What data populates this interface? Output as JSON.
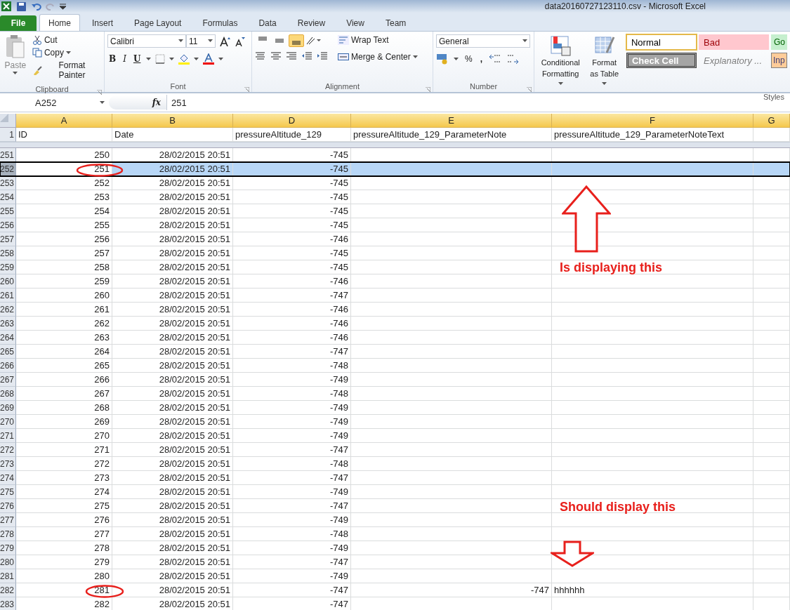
{
  "window": {
    "title": "data20160727123110.csv  -  Microsoft Excel"
  },
  "ribbon": {
    "file_tab": "File",
    "tabs": [
      {
        "label": "Home",
        "selected": true
      },
      {
        "label": "Insert",
        "selected": false
      },
      {
        "label": "Page Layout",
        "selected": false
      },
      {
        "label": "Formulas",
        "selected": false
      },
      {
        "label": "Data",
        "selected": false
      },
      {
        "label": "Review",
        "selected": false
      },
      {
        "label": "View",
        "selected": false
      },
      {
        "label": "Team",
        "selected": false
      }
    ],
    "clipboard": {
      "label": "Clipboard",
      "paste": "Paste",
      "cut": "Cut",
      "copy": "Copy",
      "format_painter": "Format Painter"
    },
    "font": {
      "label": "Font",
      "family": "Calibri",
      "size": "11",
      "bold": "B",
      "italic": "I",
      "underline": "U"
    },
    "alignment": {
      "label": "Alignment",
      "wrap_text": "Wrap Text",
      "merge_center": "Merge & Center",
      "vertical_buttons": [
        {
          "kind": "top",
          "selected": false
        },
        {
          "kind": "middle",
          "selected": false
        },
        {
          "kind": "bottom",
          "selected": true
        }
      ]
    },
    "number": {
      "label": "Number",
      "format": "General",
      "percent": "%",
      "comma": ","
    },
    "styles": {
      "label": "Styles",
      "conditional_formatting": [
        "Conditional",
        "Formatting"
      ],
      "format_as_table": [
        "Format",
        "as Table"
      ],
      "cells": [
        {
          "kind": "normal",
          "text": "Normal",
          "selected": true
        },
        {
          "kind": "bad",
          "text": "Bad",
          "selected": false
        },
        {
          "kind": "good",
          "text": "Go",
          "selected": false
        },
        {
          "kind": "check",
          "text": "Check Cell",
          "selected": false
        },
        {
          "kind": "explanatory",
          "text": "Explanatory ...",
          "selected": false
        },
        {
          "kind": "input",
          "text": "Inp",
          "selected": false
        }
      ]
    }
  },
  "formula_bar": {
    "name_box": "A252",
    "fx": "fx",
    "value": "251"
  },
  "sheet": {
    "columns": [
      "A",
      "B",
      "D",
      "E",
      "F",
      "G"
    ],
    "header_row": {
      "row": "1",
      "cells": [
        "ID",
        "Date",
        "pressureAltitude_129",
        "pressureAltitude_129_ParameterNote",
        "pressureAltitude_129_ParameterNoteText"
      ]
    },
    "rows": [
      {
        "row": "251",
        "id": "250",
        "date": "28/02/2015 20:51",
        "pressure": "-745",
        "selected": false
      },
      {
        "row": "252",
        "id": "251",
        "date": "28/02/2015 20:51",
        "pressure": "-745",
        "selected": true
      },
      {
        "row": "253",
        "id": "252",
        "date": "28/02/2015 20:51",
        "pressure": "-745",
        "selected": false
      },
      {
        "row": "254",
        "id": "253",
        "date": "28/02/2015 20:51",
        "pressure": "-745",
        "selected": false
      },
      {
        "row": "255",
        "id": "254",
        "date": "28/02/2015 20:51",
        "pressure": "-745",
        "selected": false
      },
      {
        "row": "256",
        "id": "255",
        "date": "28/02/2015 20:51",
        "pressure": "-745",
        "selected": false
      },
      {
        "row": "257",
        "id": "256",
        "date": "28/02/2015 20:51",
        "pressure": "-746",
        "selected": false
      },
      {
        "row": "258",
        "id": "257",
        "date": "28/02/2015 20:51",
        "pressure": "-745",
        "selected": false
      },
      {
        "row": "259",
        "id": "258",
        "date": "28/02/2015 20:51",
        "pressure": "-745",
        "selected": false
      },
      {
        "row": "260",
        "id": "259",
        "date": "28/02/2015 20:51",
        "pressure": "-746",
        "selected": false
      },
      {
        "row": "261",
        "id": "260",
        "date": "28/02/2015 20:51",
        "pressure": "-747",
        "selected": false
      },
      {
        "row": "262",
        "id": "261",
        "date": "28/02/2015 20:51",
        "pressure": "-746",
        "selected": false
      },
      {
        "row": "263",
        "id": "262",
        "date": "28/02/2015 20:51",
        "pressure": "-746",
        "selected": false
      },
      {
        "row": "264",
        "id": "263",
        "date": "28/02/2015 20:51",
        "pressure": "-746",
        "selected": false
      },
      {
        "row": "265",
        "id": "264",
        "date": "28/02/2015 20:51",
        "pressure": "-747",
        "selected": false
      },
      {
        "row": "266",
        "id": "265",
        "date": "28/02/2015 20:51",
        "pressure": "-748",
        "selected": false
      },
      {
        "row": "267",
        "id": "266",
        "date": "28/02/2015 20:51",
        "pressure": "-749",
        "selected": false
      },
      {
        "row": "268",
        "id": "267",
        "date": "28/02/2015 20:51",
        "pressure": "-748",
        "selected": false
      },
      {
        "row": "269",
        "id": "268",
        "date": "28/02/2015 20:51",
        "pressure": "-749",
        "selected": false
      },
      {
        "row": "270",
        "id": "269",
        "date": "28/02/2015 20:51",
        "pressure": "-749",
        "selected": false
      },
      {
        "row": "271",
        "id": "270",
        "date": "28/02/2015 20:51",
        "pressure": "-749",
        "selected": false
      },
      {
        "row": "272",
        "id": "271",
        "date": "28/02/2015 20:51",
        "pressure": "-747",
        "selected": false
      },
      {
        "row": "273",
        "id": "272",
        "date": "28/02/2015 20:51",
        "pressure": "-748",
        "selected": false
      },
      {
        "row": "274",
        "id": "273",
        "date": "28/02/2015 20:51",
        "pressure": "-747",
        "selected": false
      },
      {
        "row": "275",
        "id": "274",
        "date": "28/02/2015 20:51",
        "pressure": "-749",
        "selected": false
      },
      {
        "row": "276",
        "id": "275",
        "date": "28/02/2015 20:51",
        "pressure": "-747",
        "selected": false
      },
      {
        "row": "277",
        "id": "276",
        "date": "28/02/2015 20:51",
        "pressure": "-749",
        "selected": false
      },
      {
        "row": "278",
        "id": "277",
        "date": "28/02/2015 20:51",
        "pressure": "-748",
        "selected": false
      },
      {
        "row": "279",
        "id": "278",
        "date": "28/02/2015 20:51",
        "pressure": "-749",
        "selected": false
      },
      {
        "row": "280",
        "id": "279",
        "date": "28/02/2015 20:51",
        "pressure": "-747",
        "selected": false
      },
      {
        "row": "281",
        "id": "280",
        "date": "28/02/2015 20:51",
        "pressure": "-749",
        "selected": false
      },
      {
        "row": "282",
        "id": "281",
        "date": "28/02/2015 20:51",
        "pressure": "-747",
        "note": "-747",
        "note_text": "hhhhhh",
        "selected": false
      },
      {
        "row": "283",
        "id": "282",
        "date": "28/02/2015 20:51",
        "pressure": "-747",
        "selected": false
      }
    ]
  },
  "annotations": [
    {
      "kind": "circle"
    },
    {
      "kind": "circle"
    },
    {
      "kind": "up_arrow"
    },
    {
      "kind": "label",
      "text": "Is displaying this"
    },
    {
      "kind": "label",
      "text": "Should display this"
    },
    {
      "kind": "down_arrow"
    }
  ]
}
